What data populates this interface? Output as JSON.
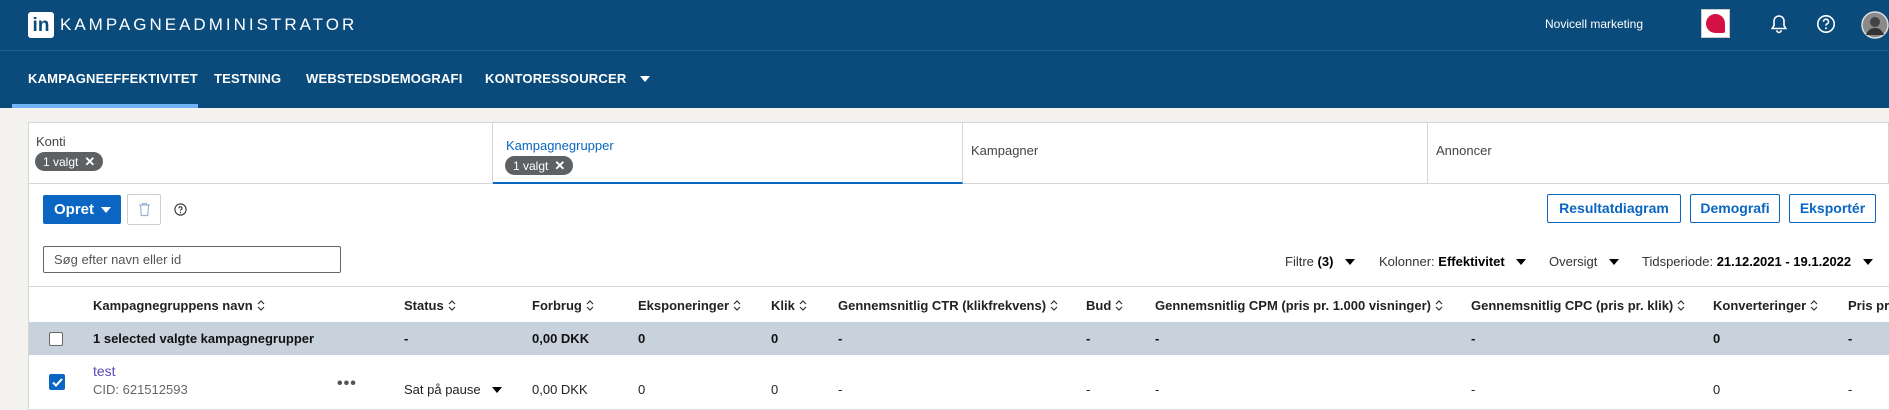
{
  "header": {
    "logo": "in",
    "app_title": "KAMPAGNEADMINISTRATOR",
    "account_name": "Novicell marketing"
  },
  "nav": {
    "items": [
      "KAMPAGNEEFFEKTIVITET",
      "TESTNING",
      "WEBSTEDSDEMOGRAFI",
      "KONTORESSOURCER"
    ],
    "active_index": 0
  },
  "filters": {
    "konti": {
      "label": "Konti",
      "chip": "1 valgt"
    },
    "kampagnegrupper": {
      "label": "Kampagnegrupper",
      "chip": "1 valgt"
    },
    "kampagner": {
      "label": "Kampagner"
    },
    "annoncer": {
      "label": "Annoncer"
    }
  },
  "toolbar": {
    "create_label": "Opret",
    "buttons": [
      "Resultatdiagram",
      "Demografi",
      "Eksportér"
    ]
  },
  "search": {
    "placeholder": "Søg efter navn eller id"
  },
  "controls": {
    "filters_label": "Filtre",
    "filters_count": "(3)",
    "columns_label": "Kolonner:",
    "columns_value": "Effektivitet",
    "view_label": "Oversigt",
    "period_label": "Tidsperiode:",
    "period_value": "21.12.2021 - 19.1.2022"
  },
  "table": {
    "headers": [
      "Kampagnegruppens navn",
      "Status",
      "Forbrug",
      "Eksponeringer",
      "Klik",
      "Gennemsnitlig CTR (klikfrekvens)",
      "Bud",
      "Gennemsnitlig CPM (pris pr. 1.000 visninger)",
      "Gennemsnitlig CPC (pris pr. klik)",
      "Konverteringer",
      "Pris pr."
    ],
    "summary": [
      "1 selected valgte kampagnegrupper",
      "-",
      "0,00 DKK",
      "0",
      "0",
      "-",
      "-",
      "-",
      "-",
      "0",
      "-"
    ],
    "rows": [
      {
        "name": "test",
        "cid": "CID: 621512593",
        "more": "•••",
        "status": "Sat på pause",
        "cells": [
          "0,00 DKK",
          "0",
          "0",
          "-",
          "-",
          "-",
          "-",
          "0",
          "-"
        ]
      }
    ]
  },
  "colors": {
    "header_bg": "#0a4b7c",
    "accent": "#0a66c2",
    "summary_bg": "#c8d2dc",
    "link": "#5b4ab8"
  }
}
